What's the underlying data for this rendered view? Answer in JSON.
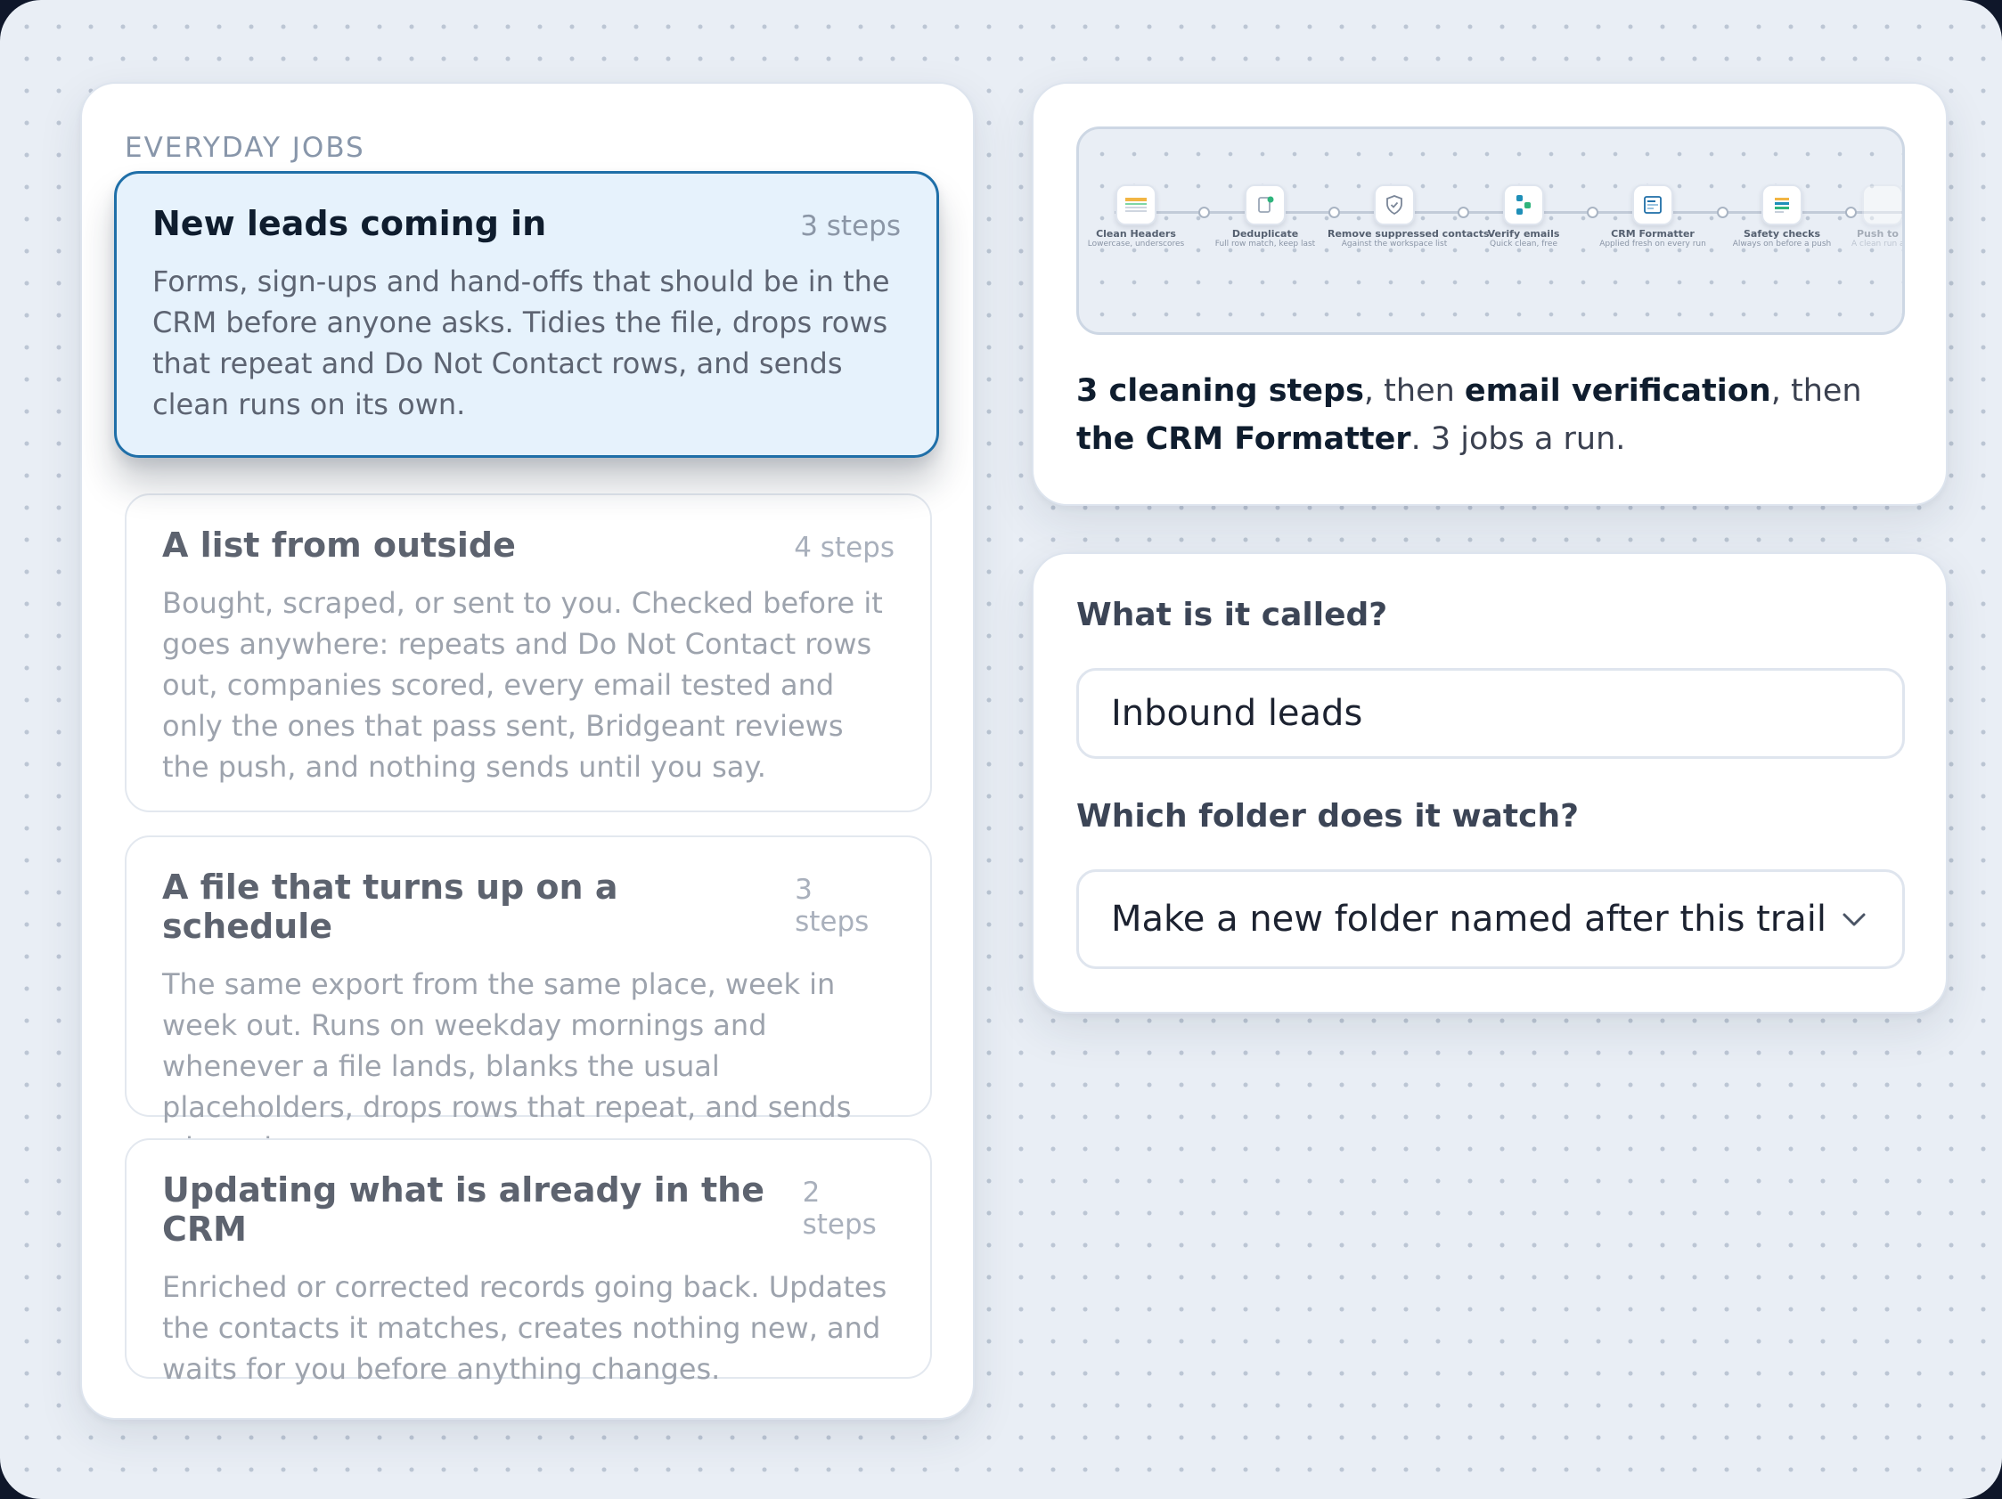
{
  "jobs_section": {
    "label": "EVERYDAY JOBS",
    "items": [
      {
        "title": "New leads coming in",
        "steps": "3 steps",
        "description": "Forms, sign-ups and hand-offs that should be in the CRM before anyone asks. Tidies the file, drops rows that repeat and Do Not Contact rows, and sends clean runs on its own.",
        "selected": true
      },
      {
        "title": "A list from outside",
        "steps": "4 steps",
        "description": "Bought, scraped, or sent to you. Checked before it goes anywhere: repeats and Do Not Contact rows out, companies scored, every email tested and only the ones that pass sent, Bridgeant reviews the push, and nothing sends until you say."
      },
      {
        "title": "A file that turns up on a schedule",
        "steps": "3 steps",
        "description": "The same export from the same place, week in week out. Runs on weekday mornings and whenever a file lands, blanks the usual placeholders, drops rows that repeat, and sends when clean."
      },
      {
        "title": "Updating what is already in the CRM",
        "steps": "2 steps",
        "description": "Enriched or corrected records going back. Updates the contacts it matches, creates nothing new, and waits for you before anything changes."
      }
    ]
  },
  "preview": {
    "steps": [
      {
        "name": "Clean Headers",
        "sub": "Lowercase, underscores",
        "icon": "table-header-icon"
      },
      {
        "name": "Deduplicate",
        "sub": "Full row match, keep last",
        "icon": "document-dedupe-icon"
      },
      {
        "name": "Remove suppressed contacts",
        "sub": "Against the workspace list",
        "icon": "shield-check-icon"
      },
      {
        "name": "Verify emails",
        "sub": "Quick clean, free",
        "icon": "verify-nodes-icon"
      },
      {
        "name": "CRM Formatter",
        "sub": "Applied fresh on every run",
        "icon": "formatter-doc-icon"
      },
      {
        "name": "Safety checks",
        "sub": "Always on before a push",
        "icon": "checklist-icon"
      },
      {
        "name": "Push to",
        "sub": "A clean run a",
        "icon": "push-icon"
      }
    ],
    "summary": {
      "s1": "3 cleaning steps",
      "s2": ", then ",
      "s3": "email verification",
      "s4": ", then ",
      "s5": "the CRM Formatter",
      "s6": ". 3 jobs a run."
    }
  },
  "form": {
    "name_label": "What is it called?",
    "name_value": "Inbound leads",
    "folder_label": "Which folder does it watch?",
    "folder_value": "Make a new folder named after this trail"
  },
  "colors": {
    "selected_border": "#1f6fa8",
    "selected_bg": "#e6f2fc",
    "page_bg": "#e9eef5"
  }
}
